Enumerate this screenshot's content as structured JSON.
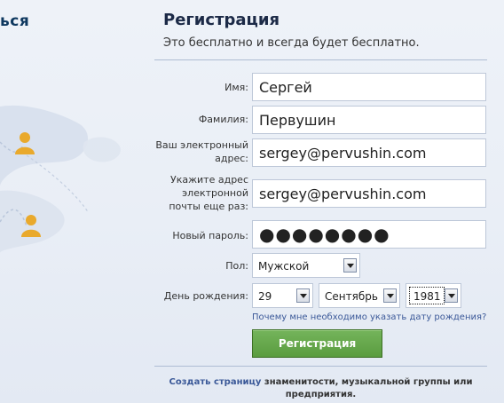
{
  "left": {
    "heading": "ься"
  },
  "form": {
    "title": "Регистрация",
    "subtitle": "Это бесплатно и всегда будет бесплатно.",
    "first_name": {
      "label": "Имя:",
      "value": "Сергей"
    },
    "last_name": {
      "label": "Фамилия:",
      "value": "Первушин"
    },
    "email": {
      "label_line1": "Ваш электронный",
      "label_line2": "адрес:",
      "value": "sergey@pervushin.com"
    },
    "email_confirm": {
      "label_line1": "Укажите адрес",
      "label_line2": "электронной",
      "label_line3": "почты еще раз:",
      "value": "sergey@pervushin.com"
    },
    "password": {
      "label": "Новый пароль:",
      "value": "●●●●●●●●"
    },
    "sex": {
      "label": "Пол:",
      "value": "Мужской"
    },
    "birthday": {
      "label": "День рождения:",
      "day": "29",
      "month": "Сентябрь",
      "year": "1981"
    },
    "birthday_help": "Почему мне необходимо указать дату рождения?",
    "submit_label": "Регистрация",
    "footer_link": "Создать страницу",
    "footer_text_1": " знаменитости, музыкальной группы или",
    "footer_text_2": "предприятия."
  },
  "colors": {
    "accent": "#3b5998",
    "button": "#69a74e",
    "heading": "#1c2a47"
  },
  "icons": [
    "person-icon",
    "chevron-down-icon"
  ]
}
